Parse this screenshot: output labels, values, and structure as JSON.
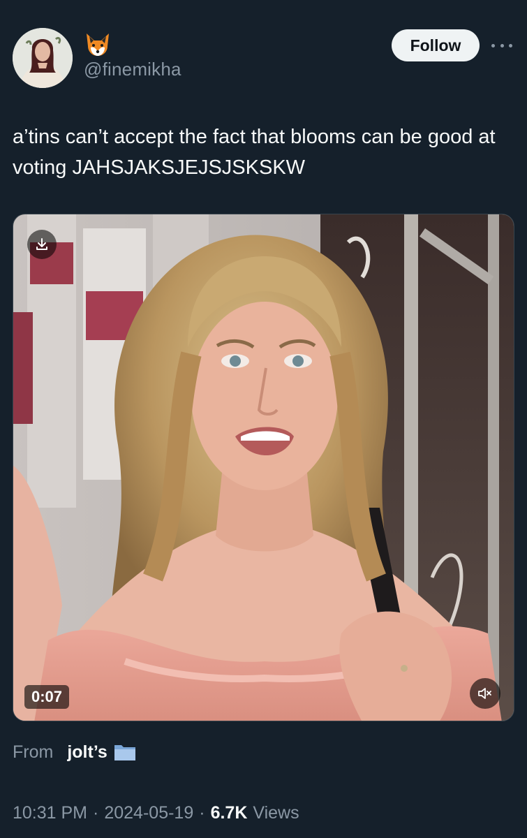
{
  "tweet": {
    "author": {
      "display_name_emoji": "🦊",
      "handle": "@finemikha"
    },
    "follow_label": "Follow",
    "text": "a’tins can’t accept the fact that blooms can be good at voting JAHSJAKSJEJSJSKSKW",
    "media": {
      "type": "video",
      "duration": "0:07",
      "muted": true
    },
    "from": {
      "label": "From",
      "source": "jolt’s",
      "source_emoji": "📁"
    },
    "meta": {
      "time": "10:31 PM",
      "separator": "·",
      "date": "2024-05-19",
      "views_count": "6.7K",
      "views_label": "Views"
    }
  },
  "colors": {
    "background": "#15202b",
    "text_primary": "#f7f9f9",
    "text_secondary": "#8b98a5",
    "follow_button_bg": "#eff3f4",
    "follow_button_text": "#0f1419"
  },
  "icons": {
    "more": "more-horizontal-icon",
    "download": "download-icon",
    "mute": "volume-muted-icon",
    "folder": "folder-icon"
  }
}
